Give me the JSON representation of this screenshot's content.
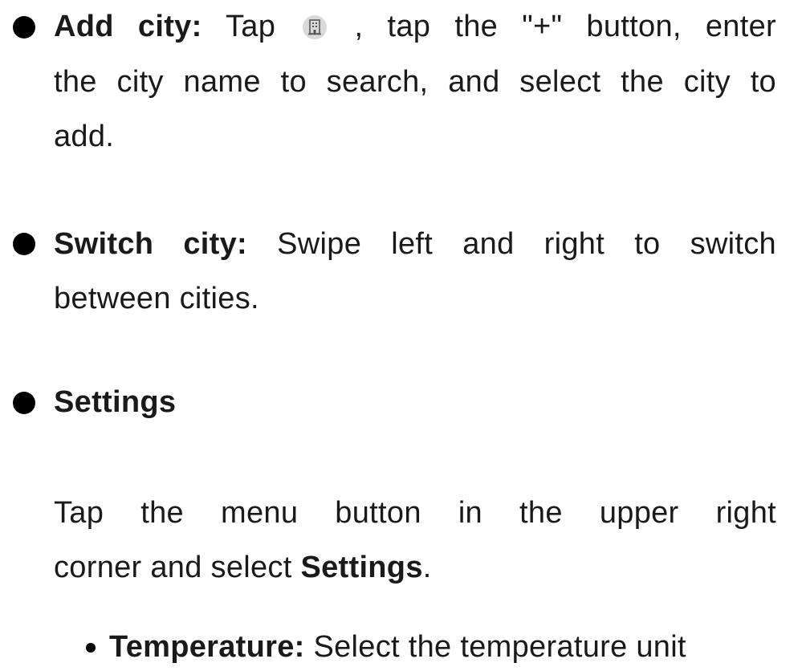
{
  "add_city": {
    "heading": "Add city:",
    "line1_before_icon": " Tap ",
    "icon_name": "building-icon",
    "line1_after_icon": " , tap the \"+\" button, enter",
    "line2": "the city name to search, and select the city to",
    "line3": "add."
  },
  "switch_city": {
    "heading": "Switch city:",
    "line1": " Swipe left and right to switch",
    "line2": "between cities."
  },
  "settings": {
    "heading": "Settings",
    "line1": "Tap the menu button in the upper right",
    "line2_before": "corner and select ",
    "line2_bold": "Settings",
    "line2_after": "."
  },
  "temperature": {
    "heading": "Temperature:",
    "text": " Select the temperature unit"
  }
}
